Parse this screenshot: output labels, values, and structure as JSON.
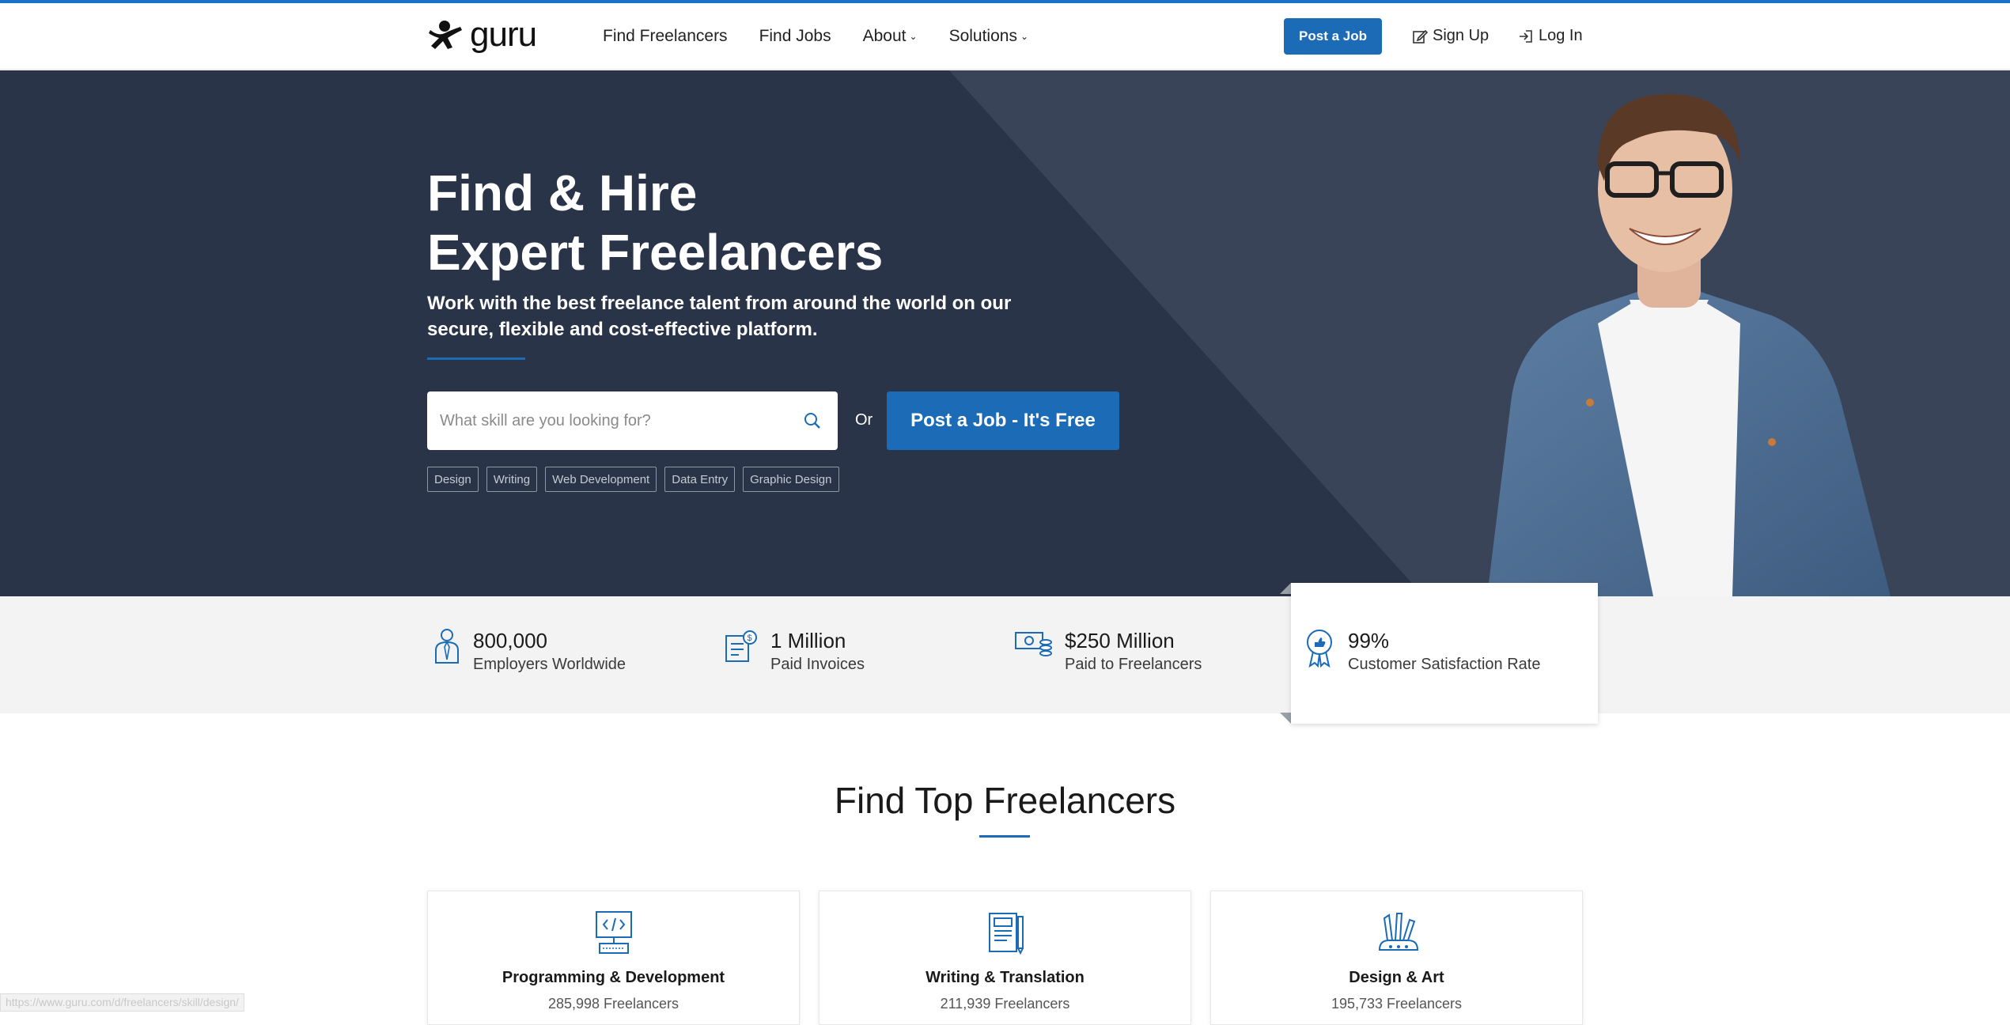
{
  "header": {
    "logo_text": "guru",
    "nav": [
      "Find Freelancers",
      "Find Jobs",
      "About",
      "Solutions"
    ],
    "post_job_label": "Post a Job",
    "signup_label": "Sign Up",
    "login_label": "Log In"
  },
  "hero": {
    "title_line1": "Find & Hire",
    "title_line2": "Expert Freelancers",
    "subtitle": "Work with the best freelance talent from around the world on our secure, flexible and cost-effective platform.",
    "search_placeholder": "What skill are you looking for?",
    "or_label": "Or",
    "post_job_label": "Post a Job - It's Free",
    "tags": [
      "Design",
      "Writing",
      "Web Development",
      "Data Entry",
      "Graphic Design"
    ]
  },
  "stats": [
    {
      "value": "800,000",
      "label": "Employers Worldwide",
      "icon": "employer-icon"
    },
    {
      "value": "1 Million",
      "label": "Paid Invoices",
      "icon": "invoice-icon"
    },
    {
      "value": "$250 Million",
      "label": "Paid to Freelancers",
      "icon": "money-icon"
    },
    {
      "value": "99%",
      "label": "Customer Satisfaction Rate",
      "icon": "award-icon"
    }
  ],
  "section": {
    "title": "Find Top Freelancers",
    "cards": [
      {
        "title": "Programming & Development",
        "count": "285,998 Freelancers",
        "icon": "computer-code-icon"
      },
      {
        "title": "Writing & Translation",
        "count": "211,939 Freelancers",
        "icon": "document-pen-icon"
      },
      {
        "title": "Design & Art",
        "count": "195,733 Freelancers",
        "icon": "brushes-icon"
      }
    ]
  },
  "status_url": "https://www.guru.com/d/freelancers/skill/design/",
  "colors": {
    "accent": "#1b6bb7",
    "hero_bg": "#2f3a50",
    "topbar": "#1a73c8"
  }
}
